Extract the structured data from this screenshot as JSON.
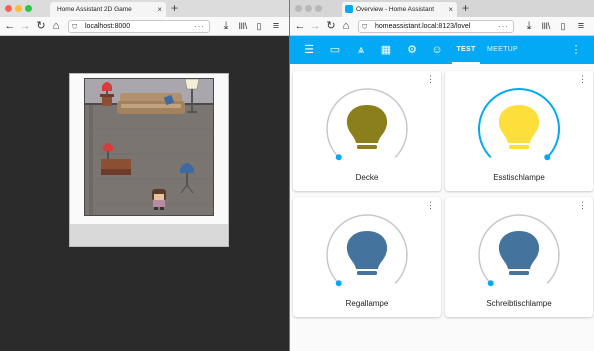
{
  "left_window": {
    "tab_title": "Home Assistant 2D Game",
    "url": "localhost:8000",
    "traffic_colors": [
      "#fe5f57",
      "#febc2e",
      "#28c840"
    ]
  },
  "right_window": {
    "tab_title": "Overview - Home Assistant",
    "url": "homeassistant.local:8123/lovel",
    "traffic_colors": [
      "#b8b8b8",
      "#b8b8b8",
      "#b8b8b8"
    ]
  },
  "ha": {
    "accent": "#03a9f4",
    "views": [
      {
        "label": "TEST",
        "active": true
      },
      {
        "label": "MEETUP",
        "active": false
      }
    ],
    "header_icons": [
      "menu-icon",
      "sofa-icon",
      "lamp-icon",
      "calendar-icon",
      "cog-icon",
      "robot-icon"
    ],
    "lights": [
      {
        "name": "Decke",
        "state": "on",
        "brightness_pct": 0,
        "color": "#8a7f1c"
      },
      {
        "name": "Esstischlampe",
        "state": "on",
        "brightness_pct": 100,
        "color": "#fddf3c"
      },
      {
        "name": "Regallampe",
        "state": "off",
        "brightness_pct": 0,
        "color": "#44739e"
      },
      {
        "name": "Schreibtischlampe",
        "state": "off",
        "brightness_pct": 0,
        "color": "#44739e"
      }
    ]
  }
}
